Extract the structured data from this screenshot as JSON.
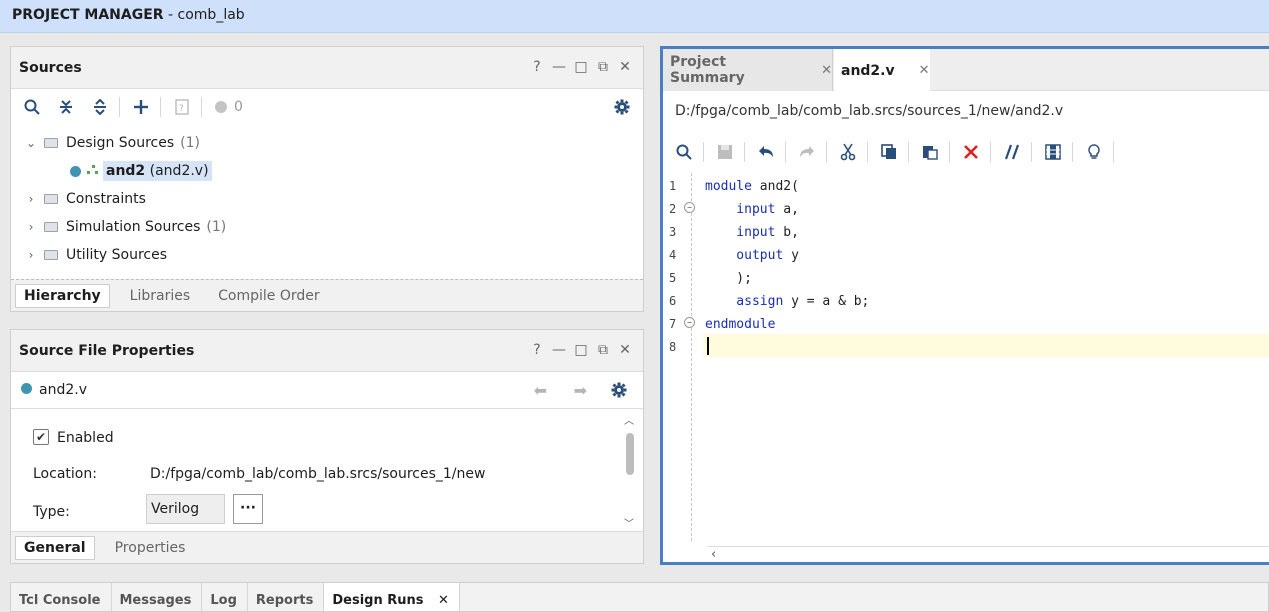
{
  "topbar": {
    "section": "PROJECT MANAGER",
    "project": "- comb_lab"
  },
  "sources": {
    "title": "Sources",
    "controls": [
      "?",
      "—",
      "□",
      "⧉",
      "✕"
    ],
    "error_count": "0",
    "tree": {
      "design_sources": "Design Sources",
      "design_count": "(1)",
      "module_name": "and2",
      "module_file": "(and2.v)",
      "constraints": "Constraints",
      "simulation_sources": "Simulation Sources",
      "sim_count": "(1)",
      "utility_sources": "Utility Sources"
    },
    "tabs": [
      "Hierarchy",
      "Libraries",
      "Compile Order"
    ]
  },
  "props": {
    "title": "Source File Properties",
    "controls": [
      "?",
      "—",
      "□",
      "⧉",
      "✕"
    ],
    "file": "and2.v",
    "enabled_label": "Enabled",
    "location_label": "Location:",
    "location_value": "D:/fpga/comb_lab/comb_lab.srcs/sources_1/new",
    "type_label": "Type:",
    "type_value": "Verilog",
    "more": "···",
    "tabs": [
      "General",
      "Properties"
    ]
  },
  "editor": {
    "tabs": [
      "Project Summary",
      "and2.v"
    ],
    "path": "D:/fpga/comb_lab/comb_lab.srcs/sources_1/new/and2.v",
    "lines": [
      {
        "n": "1",
        "kw": "module",
        "rest": " and2("
      },
      {
        "n": "2",
        "kw": "    input",
        "rest": " a,"
      },
      {
        "n": "3",
        "kw": "    input",
        "rest": " b,"
      },
      {
        "n": "4",
        "kw": "    output",
        "rest": " y"
      },
      {
        "n": "5",
        "kw": "",
        "rest": "    );"
      },
      {
        "n": "6",
        "kw": "    assign",
        "rest": " y = a & b;"
      },
      {
        "n": "7",
        "kw": "endmodule",
        "rest": ""
      },
      {
        "n": "8",
        "kw": "",
        "rest": ""
      }
    ]
  },
  "bottom": {
    "tabs": [
      "Tcl Console",
      "Messages",
      "Log",
      "Reports",
      "Design Runs"
    ]
  }
}
